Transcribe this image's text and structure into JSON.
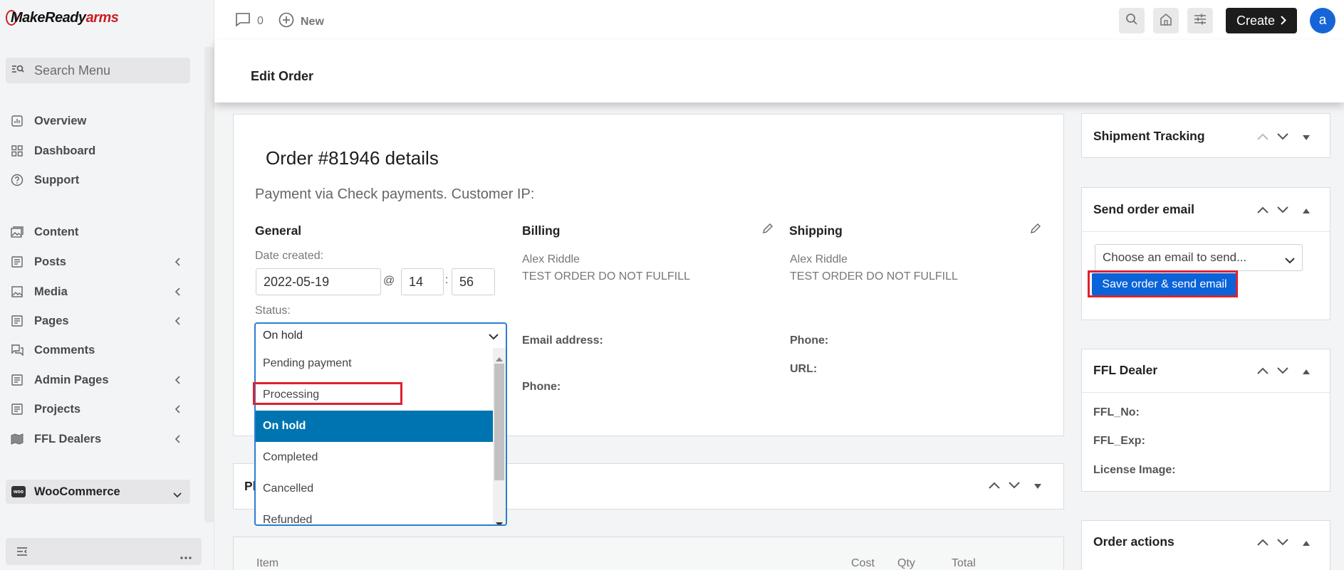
{
  "brand": {
    "logo_prefix": "MakeReady",
    "logo_suffix": "arms",
    "accent": "#cc1d26"
  },
  "sidebar": {
    "search_placeholder": "Search Menu",
    "items": [
      {
        "label": "Overview",
        "icon": "chart-icon",
        "submenu": false
      },
      {
        "label": "Dashboard",
        "icon": "grid-icon",
        "submenu": false
      },
      {
        "label": "Support",
        "icon": "help-icon",
        "submenu": false
      },
      {
        "label": "Content",
        "icon": "image-stack-icon",
        "submenu": false
      },
      {
        "label": "Posts",
        "icon": "document-icon",
        "submenu": true
      },
      {
        "label": "Media",
        "icon": "image-icon",
        "submenu": true
      },
      {
        "label": "Pages",
        "icon": "document-icon",
        "submenu": true
      },
      {
        "label": "Comments",
        "icon": "comments-icon",
        "submenu": false
      },
      {
        "label": "Admin Pages",
        "icon": "document-icon",
        "submenu": true
      },
      {
        "label": "Projects",
        "icon": "document-icon",
        "submenu": true
      },
      {
        "label": "FFL Dealers",
        "icon": "map-icon",
        "submenu": true
      }
    ],
    "woocommerce_label": "WooCommerce",
    "woocommerce_badge": "woo"
  },
  "topbar": {
    "comments_count": "0",
    "new_label": "New",
    "create_label": "Create",
    "avatar_letter": "a"
  },
  "page": {
    "title": "Edit Order"
  },
  "order": {
    "title": "Order #81946 details",
    "payment_line": "Payment via Check payments. Customer IP:",
    "general": {
      "heading": "General",
      "date_label": "Date created:",
      "date_value": "2022-05-19",
      "at_sign": "@",
      "hour": "14",
      "colon": ":",
      "minute": "56",
      "status_label": "Status:",
      "status_value": "On hold",
      "status_options": [
        "Pending payment",
        "Processing",
        "On hold",
        "Completed",
        "Cancelled",
        "Refunded"
      ],
      "status_selected_index": 2
    },
    "billing": {
      "heading": "Billing",
      "name": "Alex Riddle",
      "note": "TEST ORDER DO NOT FULFILL",
      "email_label": "Email address:",
      "phone_label": "Phone:"
    },
    "shipping": {
      "heading": "Shipping",
      "name": "Alex Riddle",
      "note": "TEST ORDER DO NOT FULFILL",
      "phone_label": "Phone:",
      "url_label": "URL:"
    }
  },
  "products_box": {
    "title_fragment": "Pl"
  },
  "items_table": {
    "headers": [
      "Item",
      "Cost",
      "Qty",
      "Total"
    ]
  },
  "side": {
    "shipment_tracking": {
      "title": "Shipment Tracking"
    },
    "send_email": {
      "title": "Send order email",
      "select_placeholder": "Choose an email to send...",
      "button_label": "Save order & send email"
    },
    "ffl_dealer": {
      "title": "FFL Dealer",
      "ffl_no_label": "FFL_No:",
      "ffl_exp_label": "FFL_Exp:",
      "license_label": "License Image:"
    },
    "order_actions": {
      "title": "Order actions"
    }
  },
  "colors": {
    "select_highlight": "#0074b0",
    "primary_button": "#0a63d9",
    "annotation_red": "#e0202e",
    "create_button": "#1c1c1c",
    "avatar": "#1565d8"
  }
}
